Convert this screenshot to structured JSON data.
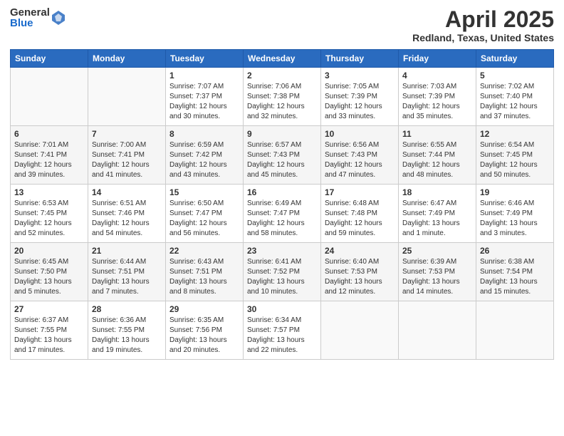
{
  "logo": {
    "general": "General",
    "blue": "Blue"
  },
  "title": "April 2025",
  "subtitle": "Redland, Texas, United States",
  "days_header": [
    "Sunday",
    "Monday",
    "Tuesday",
    "Wednesday",
    "Thursday",
    "Friday",
    "Saturday"
  ],
  "weeks": [
    [
      {
        "num": "",
        "info": ""
      },
      {
        "num": "",
        "info": ""
      },
      {
        "num": "1",
        "info": "Sunrise: 7:07 AM\nSunset: 7:37 PM\nDaylight: 12 hours\nand 30 minutes."
      },
      {
        "num": "2",
        "info": "Sunrise: 7:06 AM\nSunset: 7:38 PM\nDaylight: 12 hours\nand 32 minutes."
      },
      {
        "num": "3",
        "info": "Sunrise: 7:05 AM\nSunset: 7:39 PM\nDaylight: 12 hours\nand 33 minutes."
      },
      {
        "num": "4",
        "info": "Sunrise: 7:03 AM\nSunset: 7:39 PM\nDaylight: 12 hours\nand 35 minutes."
      },
      {
        "num": "5",
        "info": "Sunrise: 7:02 AM\nSunset: 7:40 PM\nDaylight: 12 hours\nand 37 minutes."
      }
    ],
    [
      {
        "num": "6",
        "info": "Sunrise: 7:01 AM\nSunset: 7:41 PM\nDaylight: 12 hours\nand 39 minutes."
      },
      {
        "num": "7",
        "info": "Sunrise: 7:00 AM\nSunset: 7:41 PM\nDaylight: 12 hours\nand 41 minutes."
      },
      {
        "num": "8",
        "info": "Sunrise: 6:59 AM\nSunset: 7:42 PM\nDaylight: 12 hours\nand 43 minutes."
      },
      {
        "num": "9",
        "info": "Sunrise: 6:57 AM\nSunset: 7:43 PM\nDaylight: 12 hours\nand 45 minutes."
      },
      {
        "num": "10",
        "info": "Sunrise: 6:56 AM\nSunset: 7:43 PM\nDaylight: 12 hours\nand 47 minutes."
      },
      {
        "num": "11",
        "info": "Sunrise: 6:55 AM\nSunset: 7:44 PM\nDaylight: 12 hours\nand 48 minutes."
      },
      {
        "num": "12",
        "info": "Sunrise: 6:54 AM\nSunset: 7:45 PM\nDaylight: 12 hours\nand 50 minutes."
      }
    ],
    [
      {
        "num": "13",
        "info": "Sunrise: 6:53 AM\nSunset: 7:45 PM\nDaylight: 12 hours\nand 52 minutes."
      },
      {
        "num": "14",
        "info": "Sunrise: 6:51 AM\nSunset: 7:46 PM\nDaylight: 12 hours\nand 54 minutes."
      },
      {
        "num": "15",
        "info": "Sunrise: 6:50 AM\nSunset: 7:47 PM\nDaylight: 12 hours\nand 56 minutes."
      },
      {
        "num": "16",
        "info": "Sunrise: 6:49 AM\nSunset: 7:47 PM\nDaylight: 12 hours\nand 58 minutes."
      },
      {
        "num": "17",
        "info": "Sunrise: 6:48 AM\nSunset: 7:48 PM\nDaylight: 12 hours\nand 59 minutes."
      },
      {
        "num": "18",
        "info": "Sunrise: 6:47 AM\nSunset: 7:49 PM\nDaylight: 13 hours\nand 1 minute."
      },
      {
        "num": "19",
        "info": "Sunrise: 6:46 AM\nSunset: 7:49 PM\nDaylight: 13 hours\nand 3 minutes."
      }
    ],
    [
      {
        "num": "20",
        "info": "Sunrise: 6:45 AM\nSunset: 7:50 PM\nDaylight: 13 hours\nand 5 minutes."
      },
      {
        "num": "21",
        "info": "Sunrise: 6:44 AM\nSunset: 7:51 PM\nDaylight: 13 hours\nand 7 minutes."
      },
      {
        "num": "22",
        "info": "Sunrise: 6:43 AM\nSunset: 7:51 PM\nDaylight: 13 hours\nand 8 minutes."
      },
      {
        "num": "23",
        "info": "Sunrise: 6:41 AM\nSunset: 7:52 PM\nDaylight: 13 hours\nand 10 minutes."
      },
      {
        "num": "24",
        "info": "Sunrise: 6:40 AM\nSunset: 7:53 PM\nDaylight: 13 hours\nand 12 minutes."
      },
      {
        "num": "25",
        "info": "Sunrise: 6:39 AM\nSunset: 7:53 PM\nDaylight: 13 hours\nand 14 minutes."
      },
      {
        "num": "26",
        "info": "Sunrise: 6:38 AM\nSunset: 7:54 PM\nDaylight: 13 hours\nand 15 minutes."
      }
    ],
    [
      {
        "num": "27",
        "info": "Sunrise: 6:37 AM\nSunset: 7:55 PM\nDaylight: 13 hours\nand 17 minutes."
      },
      {
        "num": "28",
        "info": "Sunrise: 6:36 AM\nSunset: 7:55 PM\nDaylight: 13 hours\nand 19 minutes."
      },
      {
        "num": "29",
        "info": "Sunrise: 6:35 AM\nSunset: 7:56 PM\nDaylight: 13 hours\nand 20 minutes."
      },
      {
        "num": "30",
        "info": "Sunrise: 6:34 AM\nSunset: 7:57 PM\nDaylight: 13 hours\nand 22 minutes."
      },
      {
        "num": "",
        "info": ""
      },
      {
        "num": "",
        "info": ""
      },
      {
        "num": "",
        "info": ""
      }
    ]
  ]
}
